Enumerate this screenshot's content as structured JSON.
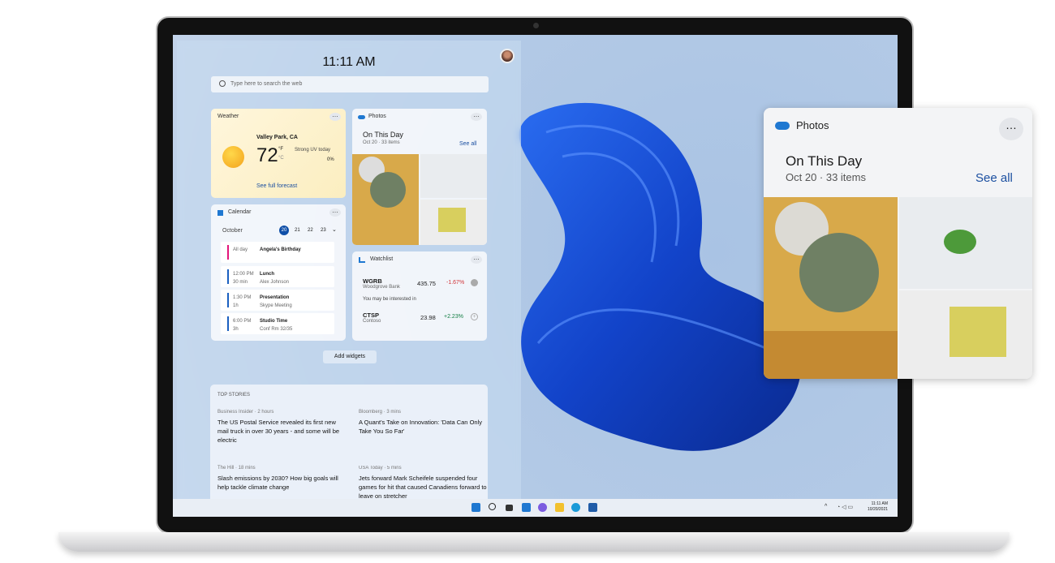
{
  "panel": {
    "time": "11:11 AM",
    "search_placeholder": "Type here to search the web",
    "add_widgets": "Add widgets"
  },
  "weather": {
    "title": "Weather",
    "location": "Valley Park, CA",
    "temp": "72",
    "unit_f": "°F",
    "unit_c": "°C",
    "condition": "Strong UV today",
    "precip": "0%",
    "link": "See full forecast"
  },
  "photos": {
    "title": "Photos",
    "heading": "On This Day",
    "sub": "Oct 20 · 33 items",
    "see_all": "See all"
  },
  "calendar": {
    "title": "Calendar",
    "month": "October",
    "days": [
      "20",
      "21",
      "22",
      "23"
    ],
    "events": [
      {
        "time": "All day",
        "dur": "",
        "name": "Angela's Birthday",
        "detail": "",
        "color": "#e3157a"
      },
      {
        "time": "12:00 PM",
        "dur": "30 min",
        "name": "Lunch",
        "detail": "Alex Johnson",
        "color": "#1a5fc0"
      },
      {
        "time": "1:30 PM",
        "dur": "1h",
        "name": "Presentation",
        "detail": "Skype Meeting",
        "color": "#1a5fc0"
      },
      {
        "time": "6:00 PM",
        "dur": "3h",
        "name": "Studio Time",
        "detail": "Conf Rm 32/35",
        "color": "#1a5fc0"
      }
    ]
  },
  "watchlist": {
    "title": "Watchlist",
    "interested": "You may be interested in",
    "stocks": [
      {
        "sym": "WGRB",
        "name": "Woodgrove Bank",
        "price": "435.75",
        "change": "-1.67%",
        "color": "#d13438"
      },
      {
        "sym": "CTSP",
        "name": "Contoso",
        "price": "23.98",
        "change": "+2.23%",
        "color": "#107c41"
      }
    ]
  },
  "news": {
    "title": "TOP STORIES",
    "stories": [
      {
        "source": "Business Insider · 2 hours",
        "headline": "The US Postal Service revealed its first new mail truck in over 30 years - and some will be electric"
      },
      {
        "source": "Bloomberg · 3 mins",
        "headline": "A Quant's Take on Innovation: 'Data Can Only Take You So Far'"
      },
      {
        "source": "The Hill · 18 mins",
        "headline": "Slash emissions by 2030? How big goals will help tackle climate change"
      },
      {
        "source": "USA Today · 5 mins",
        "headline": "Jets forward Mark Scheifele suspended four games for hit that caused Canadiens forward to leave on stretcher"
      }
    ]
  },
  "taskbar": {
    "time": "11:11 AM",
    "date": "10/20/2021",
    "icons": [
      "windows-start-icon",
      "search-icon",
      "task-view-icon",
      "widgets-icon",
      "chat-icon",
      "file-explorer-icon",
      "edge-icon",
      "store-icon"
    ]
  },
  "colors": {
    "accent": "#0f5bc4",
    "bloom": "#1d4fd8"
  }
}
